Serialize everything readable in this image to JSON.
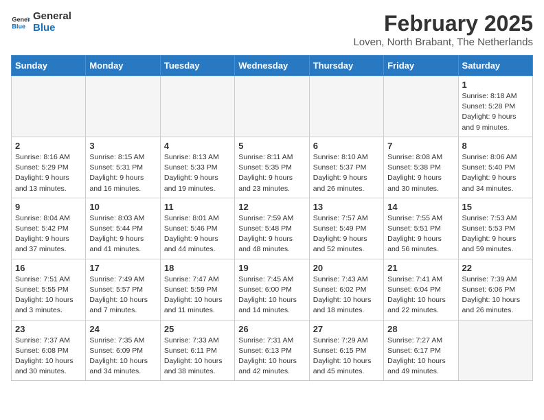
{
  "header": {
    "logo_general": "General",
    "logo_blue": "Blue",
    "title": "February 2025",
    "subtitle": "Loven, North Brabant, The Netherlands"
  },
  "days_of_week": [
    "Sunday",
    "Monday",
    "Tuesday",
    "Wednesday",
    "Thursday",
    "Friday",
    "Saturday"
  ],
  "weeks": [
    [
      {
        "day": "",
        "info": ""
      },
      {
        "day": "",
        "info": ""
      },
      {
        "day": "",
        "info": ""
      },
      {
        "day": "",
        "info": ""
      },
      {
        "day": "",
        "info": ""
      },
      {
        "day": "",
        "info": ""
      },
      {
        "day": "1",
        "info": "Sunrise: 8:18 AM\nSunset: 5:28 PM\nDaylight: 9 hours and 9 minutes."
      }
    ],
    [
      {
        "day": "2",
        "info": "Sunrise: 8:16 AM\nSunset: 5:29 PM\nDaylight: 9 hours and 13 minutes."
      },
      {
        "day": "3",
        "info": "Sunrise: 8:15 AM\nSunset: 5:31 PM\nDaylight: 9 hours and 16 minutes."
      },
      {
        "day": "4",
        "info": "Sunrise: 8:13 AM\nSunset: 5:33 PM\nDaylight: 9 hours and 19 minutes."
      },
      {
        "day": "5",
        "info": "Sunrise: 8:11 AM\nSunset: 5:35 PM\nDaylight: 9 hours and 23 minutes."
      },
      {
        "day": "6",
        "info": "Sunrise: 8:10 AM\nSunset: 5:37 PM\nDaylight: 9 hours and 26 minutes."
      },
      {
        "day": "7",
        "info": "Sunrise: 8:08 AM\nSunset: 5:38 PM\nDaylight: 9 hours and 30 minutes."
      },
      {
        "day": "8",
        "info": "Sunrise: 8:06 AM\nSunset: 5:40 PM\nDaylight: 9 hours and 34 minutes."
      }
    ],
    [
      {
        "day": "9",
        "info": "Sunrise: 8:04 AM\nSunset: 5:42 PM\nDaylight: 9 hours and 37 minutes."
      },
      {
        "day": "10",
        "info": "Sunrise: 8:03 AM\nSunset: 5:44 PM\nDaylight: 9 hours and 41 minutes."
      },
      {
        "day": "11",
        "info": "Sunrise: 8:01 AM\nSunset: 5:46 PM\nDaylight: 9 hours and 44 minutes."
      },
      {
        "day": "12",
        "info": "Sunrise: 7:59 AM\nSunset: 5:48 PM\nDaylight: 9 hours and 48 minutes."
      },
      {
        "day": "13",
        "info": "Sunrise: 7:57 AM\nSunset: 5:49 PM\nDaylight: 9 hours and 52 minutes."
      },
      {
        "day": "14",
        "info": "Sunrise: 7:55 AM\nSunset: 5:51 PM\nDaylight: 9 hours and 56 minutes."
      },
      {
        "day": "15",
        "info": "Sunrise: 7:53 AM\nSunset: 5:53 PM\nDaylight: 9 hours and 59 minutes."
      }
    ],
    [
      {
        "day": "16",
        "info": "Sunrise: 7:51 AM\nSunset: 5:55 PM\nDaylight: 10 hours and 3 minutes."
      },
      {
        "day": "17",
        "info": "Sunrise: 7:49 AM\nSunset: 5:57 PM\nDaylight: 10 hours and 7 minutes."
      },
      {
        "day": "18",
        "info": "Sunrise: 7:47 AM\nSunset: 5:59 PM\nDaylight: 10 hours and 11 minutes."
      },
      {
        "day": "19",
        "info": "Sunrise: 7:45 AM\nSunset: 6:00 PM\nDaylight: 10 hours and 14 minutes."
      },
      {
        "day": "20",
        "info": "Sunrise: 7:43 AM\nSunset: 6:02 PM\nDaylight: 10 hours and 18 minutes."
      },
      {
        "day": "21",
        "info": "Sunrise: 7:41 AM\nSunset: 6:04 PM\nDaylight: 10 hours and 22 minutes."
      },
      {
        "day": "22",
        "info": "Sunrise: 7:39 AM\nSunset: 6:06 PM\nDaylight: 10 hours and 26 minutes."
      }
    ],
    [
      {
        "day": "23",
        "info": "Sunrise: 7:37 AM\nSunset: 6:08 PM\nDaylight: 10 hours and 30 minutes."
      },
      {
        "day": "24",
        "info": "Sunrise: 7:35 AM\nSunset: 6:09 PM\nDaylight: 10 hours and 34 minutes."
      },
      {
        "day": "25",
        "info": "Sunrise: 7:33 AM\nSunset: 6:11 PM\nDaylight: 10 hours and 38 minutes."
      },
      {
        "day": "26",
        "info": "Sunrise: 7:31 AM\nSunset: 6:13 PM\nDaylight: 10 hours and 42 minutes."
      },
      {
        "day": "27",
        "info": "Sunrise: 7:29 AM\nSunset: 6:15 PM\nDaylight: 10 hours and 45 minutes."
      },
      {
        "day": "28",
        "info": "Sunrise: 7:27 AM\nSunset: 6:17 PM\nDaylight: 10 hours and 49 minutes."
      },
      {
        "day": "",
        "info": ""
      }
    ]
  ]
}
